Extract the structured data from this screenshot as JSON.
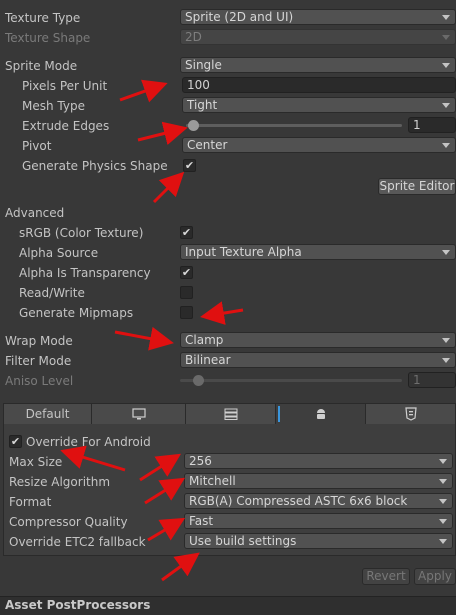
{
  "texture": {
    "type_label": "Texture Type",
    "type_value": "Sprite (2D and UI)",
    "shape_label": "Texture Shape",
    "shape_value": "2D"
  },
  "sprite": {
    "mode_label": "Sprite Mode",
    "mode_value": "Single",
    "ppu_label": "Pixels Per Unit",
    "ppu_value": "100",
    "mesh_label": "Mesh Type",
    "mesh_value": "Tight",
    "extrude_label": "Extrude Edges",
    "extrude_value": "1",
    "pivot_label": "Pivot",
    "pivot_value": "Center",
    "physics_label": "Generate Physics Shape",
    "physics_checked": "✔",
    "editor_button": "Sprite Editor"
  },
  "advanced": {
    "header": "Advanced",
    "srgb_label": "sRGB (Color Texture)",
    "srgb_checked": "✔",
    "alpha_source_label": "Alpha Source",
    "alpha_source_value": "Input Texture Alpha",
    "alpha_transp_label": "Alpha Is Transparency",
    "alpha_transp_checked": "✔",
    "readwrite_label": "Read/Write",
    "mipmaps_label": "Generate Mipmaps"
  },
  "wrap": {
    "wrap_label": "Wrap Mode",
    "wrap_value": "Clamp",
    "filter_label": "Filter Mode",
    "filter_value": "Bilinear",
    "aniso_label": "Aniso Level",
    "aniso_value": "1"
  },
  "platform": {
    "tab_default": "Default",
    "override_label": "Override For Android",
    "override_checked": "✔",
    "maxsize_label": "Max Size",
    "maxsize_value": "256",
    "resize_label": "Resize Algorithm",
    "resize_value": "Mitchell",
    "format_label": "Format",
    "format_value": "RGB(A) Compressed ASTC 6x6 block",
    "quality_label": "Compressor Quality",
    "quality_value": "Fast",
    "etc2_label": "Override ETC2 fallback",
    "etc2_value": "Use build settings"
  },
  "actions": {
    "revert": "Revert",
    "apply": "Apply"
  },
  "footer": {
    "title": "Asset PostProcessors"
  },
  "colors": {
    "background": "#383838",
    "annotation_arrow": "#e01010",
    "active_tab_accent": "#3a96dd"
  }
}
